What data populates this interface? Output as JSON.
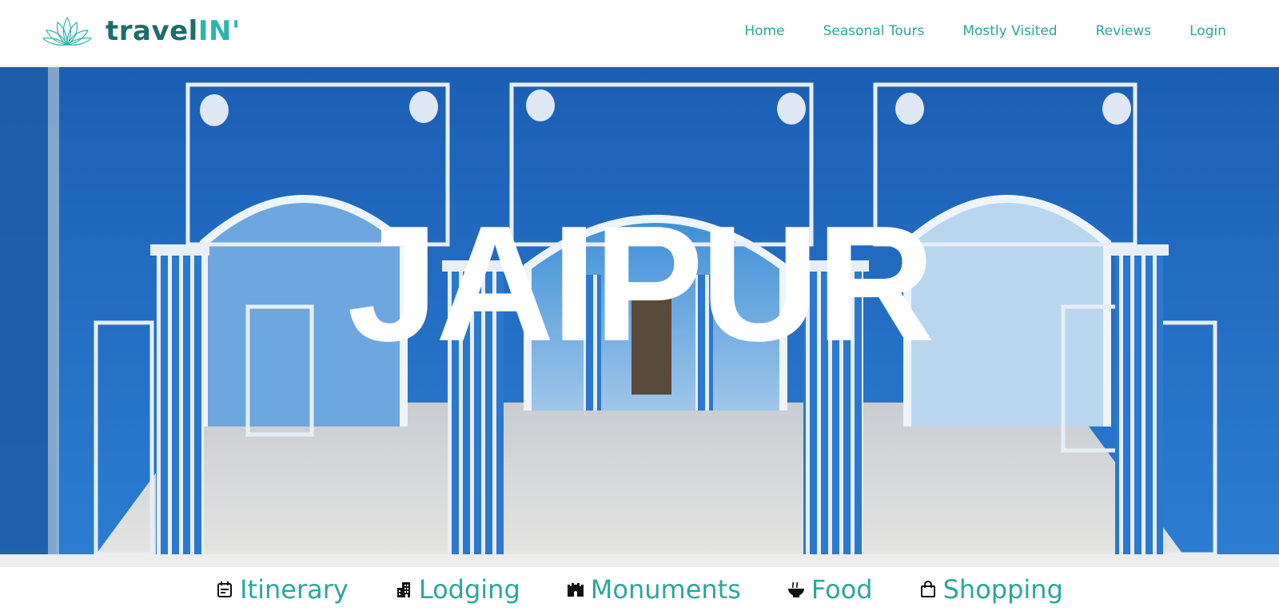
{
  "logo": {
    "text_dark": "travel",
    "text_accent": "IN'",
    "icon": "lotus-icon"
  },
  "nav": {
    "items": [
      {
        "label": "Home"
      },
      {
        "label": "Seasonal Tours"
      },
      {
        "label": "Mostly Visited"
      },
      {
        "label": "Reviews"
      },
      {
        "label": "Login"
      }
    ]
  },
  "hero": {
    "title": "JAIPUR"
  },
  "tabs": [
    {
      "label": "Itinerary",
      "icon": "calendar-icon"
    },
    {
      "label": "Lodging",
      "icon": "building-icon"
    },
    {
      "label": "Monuments",
      "icon": "castle-icon"
    },
    {
      "label": "Food",
      "icon": "bowl-icon"
    },
    {
      "label": "Shopping",
      "icon": "shopping-bag-icon"
    }
  ],
  "colors": {
    "accent": "#2aa69e",
    "brand_dark": "#1d6d6b",
    "hero_blue": "#1f6fc2"
  }
}
